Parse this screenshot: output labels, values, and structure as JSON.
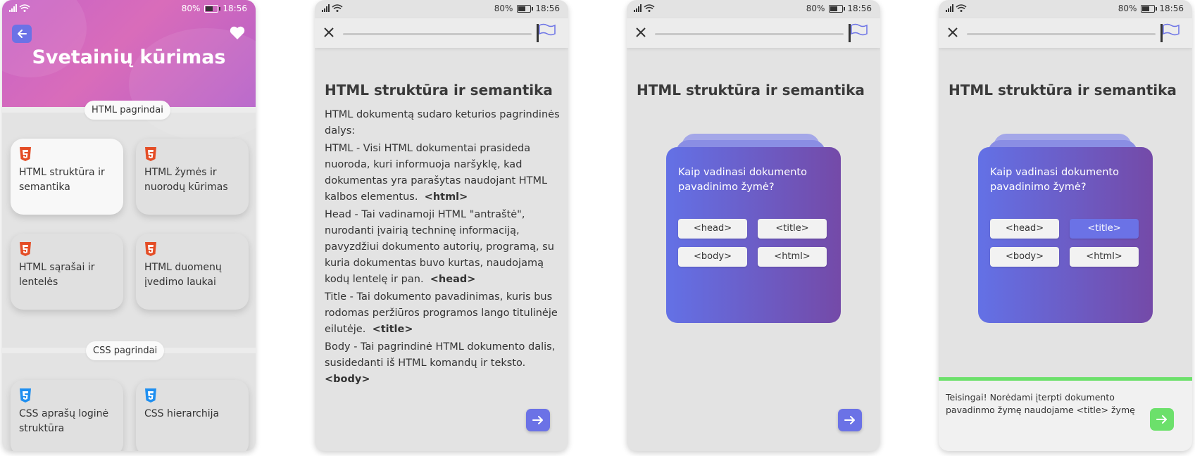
{
  "status": {
    "battery": "80%",
    "time": "18:56"
  },
  "course": {
    "title": "Svetainių kūrimas",
    "sections": [
      {
        "title": "HTML pagrindai",
        "cards": [
          {
            "label": "HTML struktūra ir semantika",
            "icon": "html5-icon"
          },
          {
            "label": "HTML žymės ir nuorodų kūrimas",
            "icon": "html5-icon"
          },
          {
            "label": "HTML sąrašai ir lentelės",
            "icon": "html5-icon"
          },
          {
            "label": "HTML duomenų įvedimo laukai",
            "icon": "html5-icon"
          }
        ]
      },
      {
        "title": "CSS pagrindai",
        "cards": [
          {
            "label": "CSS aprašų loginė struktūra",
            "icon": "css3-icon"
          },
          {
            "label": "CSS hierarchija",
            "icon": "css3-icon"
          }
        ]
      }
    ]
  },
  "lesson": {
    "title": "HTML struktūra ir semantika",
    "intro": "HTML dokumentą sudaro keturios pagrindinės dalys:",
    "parts": [
      {
        "text": "HTML - Visi HTML dokumentai prasideda nuoroda, kuri informuoja naršyklę, kad dokumentas yra parašytas naudojant HTML kalbos elementus.",
        "tag": "<html>"
      },
      {
        "text": "Head - Tai vadinamoji HTML \"antraštė\", nurodanti įvairią techninę informaciją, pavyzdžiui dokumento autorių, programą, su kuria dokumentas buvo kurtas, naudojamą kodų lentelę ir pan.",
        "tag": "<head>"
      },
      {
        "text": "Title - Tai dokumento pavadinimas, kuris bus rodomas peržiūros programos lango titulinėje eilutėje.",
        "tag": "<title>"
      },
      {
        "text": "Body - Tai pagrindinė HTML dokumento dalis, susidedanti iš HTML komandų ir teksto.",
        "tag": "<body>"
      }
    ]
  },
  "quiz": {
    "question": "Kaip vadinasi dokumento pavadinimo žymė?",
    "options": [
      "<head>",
      "<title>",
      "<body>",
      "<html>"
    ],
    "selected": "<title>",
    "feedback": "Teisingai! Norėdami įterpti dokumento pavadinmo žymę naudojame <title> žymę"
  },
  "colors": {
    "accent": "#6b72e6",
    "success": "#6ce06b",
    "hero": "#c764c7"
  }
}
